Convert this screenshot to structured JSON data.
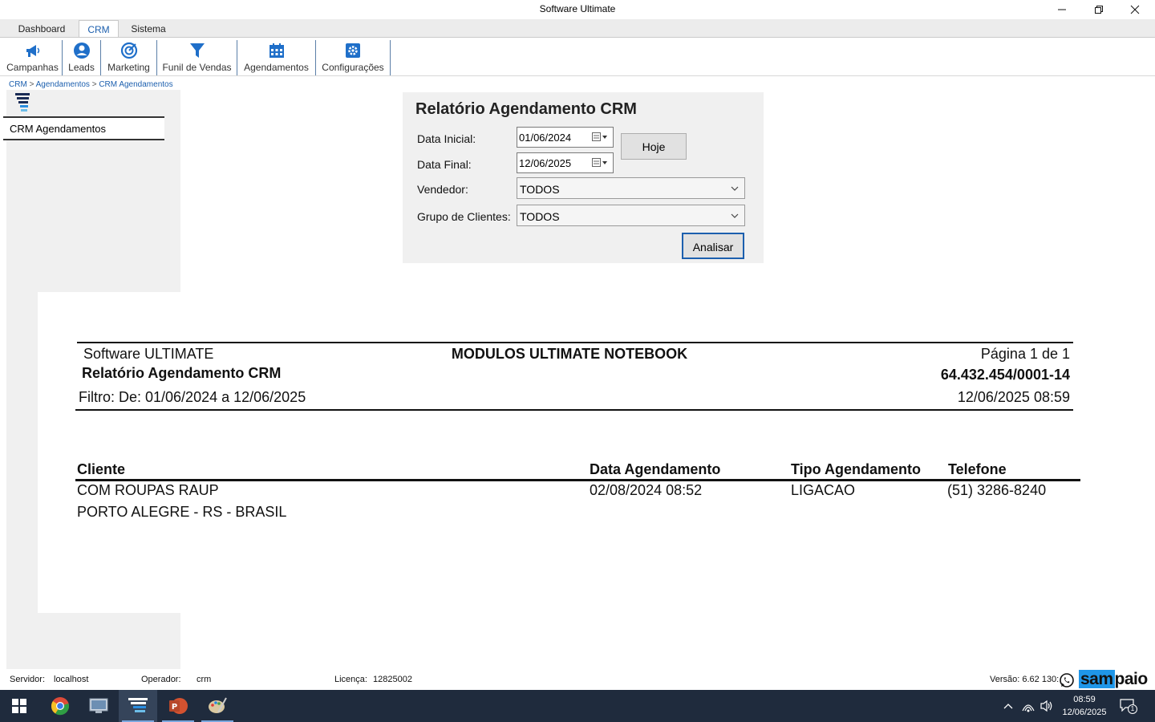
{
  "window": {
    "title": "Software Ultimate"
  },
  "tabs": [
    {
      "label": "Dashboard"
    },
    {
      "label": "CRM"
    },
    {
      "label": "Sistema"
    }
  ],
  "ribbon": [
    {
      "label": "Campanhas",
      "icon": "megaphone-icon"
    },
    {
      "label": "Leads",
      "icon": "user-icon"
    },
    {
      "label": "Marketing",
      "icon": "target-icon"
    },
    {
      "label": "Funil de Vendas",
      "icon": "funnel-icon"
    },
    {
      "label": "Agendamentos",
      "icon": "calendar-icon"
    },
    {
      "label": "Configurações",
      "icon": "gear-icon"
    }
  ],
  "breadcrumb": {
    "items": [
      "CRM",
      "Agendamentos",
      "CRM Agendamentos"
    ],
    "separator": ">"
  },
  "sidebar": {
    "item": "CRM Agendamentos"
  },
  "filter": {
    "title": "Relatório Agendamento CRM",
    "data_inicial_label": "Data Inicial:",
    "data_inicial_value": "01/06/2024",
    "data_final_label": "Data Final:",
    "data_final_value": "12/06/2025",
    "hoje_label": "Hoje",
    "vendedor_label": "Vendedor:",
    "vendedor_value": "TODOS",
    "grupo_label": "Grupo de Clientes:",
    "grupo_value": "TODOS",
    "analisar_label": "Analisar"
  },
  "report": {
    "company": "Software ULTIMATE",
    "module": "MODULOS ULTIMATE NOTEBOOK",
    "page": "Página 1 de 1",
    "title": "Relatório Agendamento CRM",
    "cnpj": "64.432.454/0001-14",
    "filter": "Filtro:  De: 01/06/2024 a 12/06/2025",
    "datetime": "12/06/2025 08:59",
    "columns": [
      "Cliente",
      "Data Agendamento",
      "Tipo Agendamento",
      "Telefone"
    ],
    "rows": [
      {
        "cliente": "COM ROUPAS RAUP",
        "local": "PORTO ALEGRE - RS - BRASIL",
        "data": "02/08/2024 08:52",
        "tipo": "LIGACAO",
        "telefone": "(51) 3286-8240"
      }
    ]
  },
  "status": {
    "servidor_label": "Servidor:",
    "servidor_value": "localhost",
    "operador_label": "Operador:",
    "operador_value": "crm",
    "licenca_label": "Licença:",
    "licenca_value": "12825002",
    "versao": "Versão: 6.62 130:",
    "logo_a": "sam",
    "logo_b": "paio"
  },
  "taskbar": {
    "time": "08:59",
    "date": "12/06/2025",
    "notifications": "1"
  },
  "colors": {
    "accent": "#1c5fae",
    "logo_highlight": "#1f96e8",
    "taskbar": "#1f2b3d"
  }
}
